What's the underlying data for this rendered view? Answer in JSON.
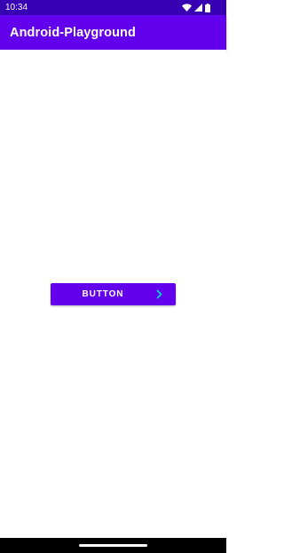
{
  "status_bar": {
    "time": "10:34",
    "icons": [
      "wifi-icon",
      "cell-signal-icon",
      "battery-icon"
    ]
  },
  "app_bar": {
    "title": "Android-Playground"
  },
  "main": {
    "button_label": "BUTTON",
    "button_icon": "chevron-right-icon"
  },
  "colors": {
    "primary": "#6200ee",
    "primary_dark": "#3700b3",
    "chevron": "#03dac5",
    "nav_bar": "#000000",
    "background": "#ffffff"
  }
}
